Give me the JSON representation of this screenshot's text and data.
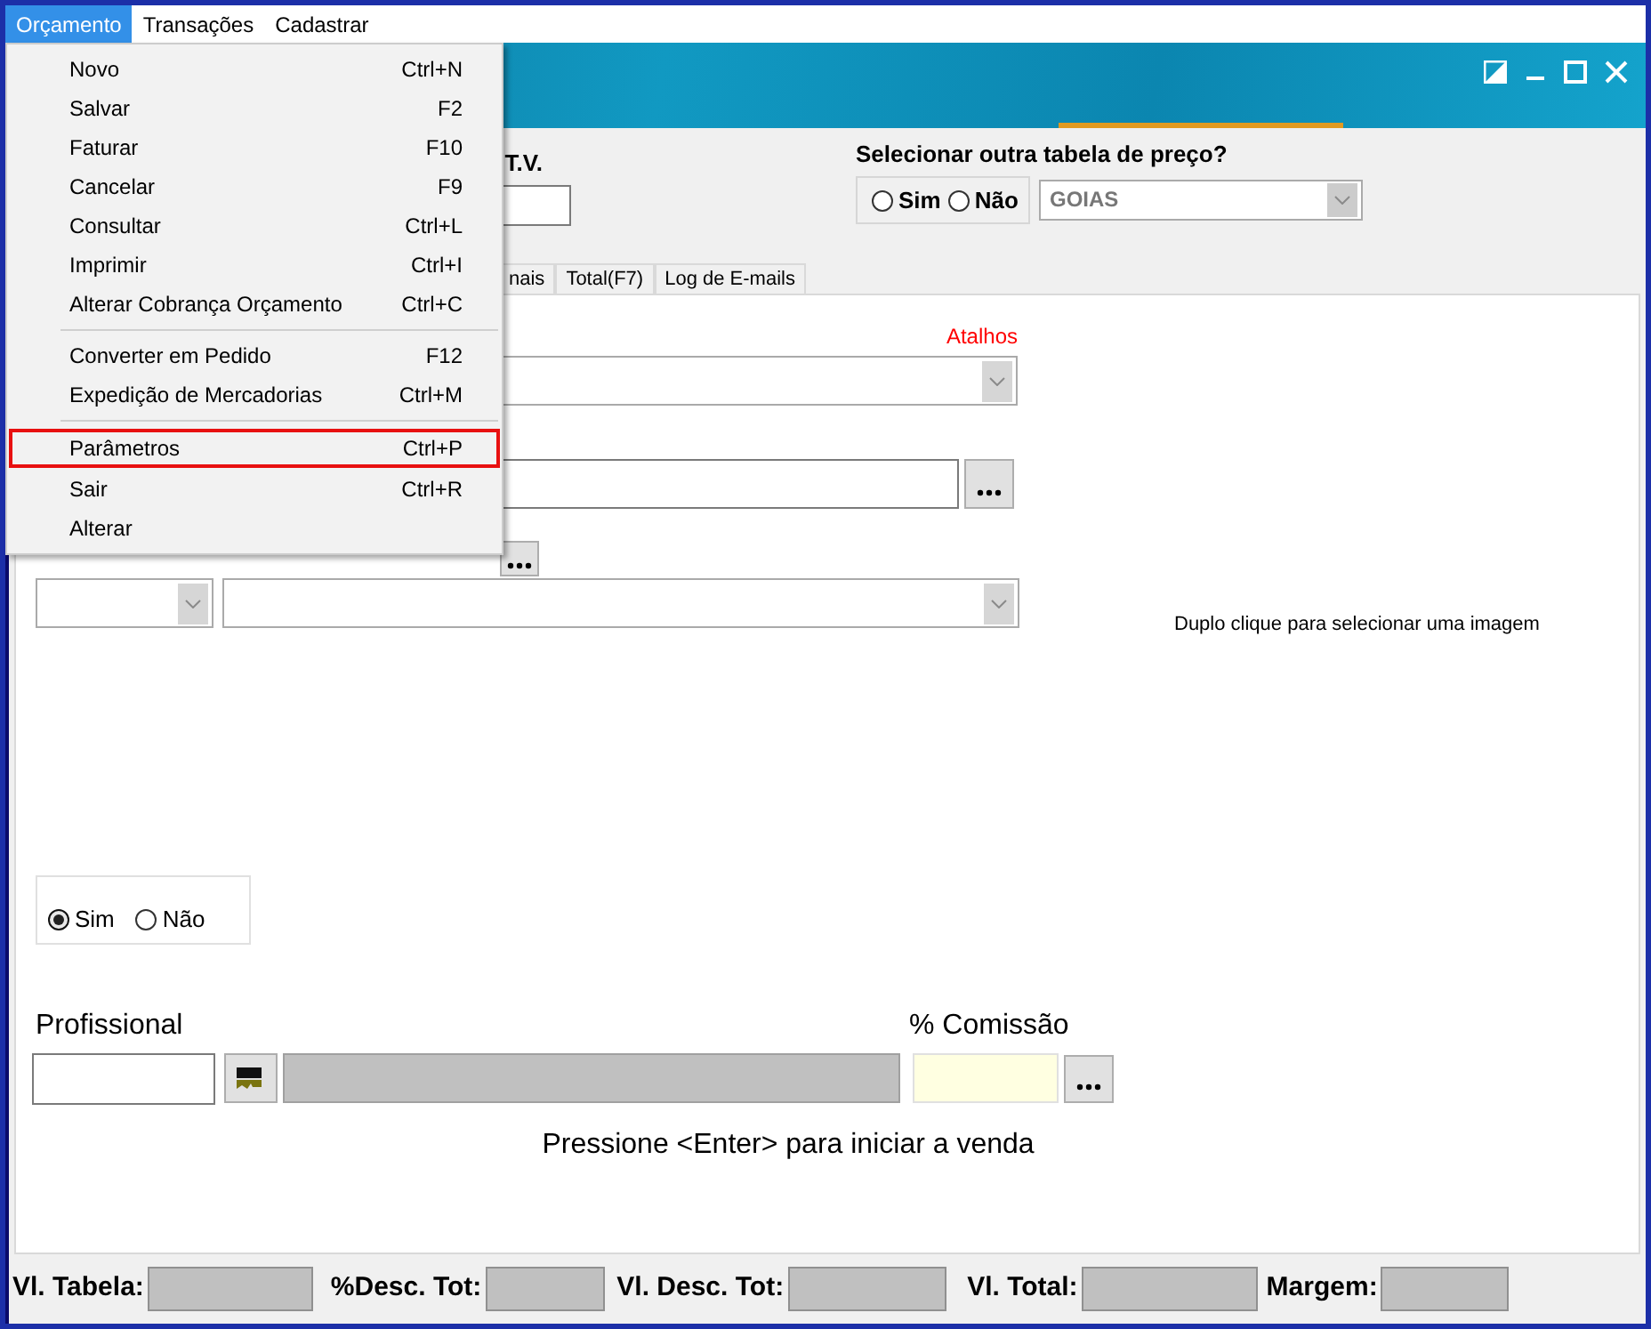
{
  "menu_bar": [
    {
      "label": "Orçamento",
      "selected": true
    },
    {
      "label": "Transações",
      "selected": false
    },
    {
      "label": "Cadastrar",
      "selected": false
    }
  ],
  "menu": {
    "items": [
      {
        "kind": "item",
        "label": "Novo",
        "shortcut": "Ctrl+N",
        "highlighted": false
      },
      {
        "kind": "item",
        "label": "Salvar",
        "shortcut": "F2",
        "highlighted": false
      },
      {
        "kind": "item",
        "label": "Faturar",
        "shortcut": "F10",
        "highlighted": false
      },
      {
        "kind": "item",
        "label": "Cancelar",
        "shortcut": "F9",
        "highlighted": false
      },
      {
        "kind": "item",
        "label": "Consultar",
        "shortcut": "Ctrl+L",
        "highlighted": false
      },
      {
        "kind": "item",
        "label": "Imprimir",
        "shortcut": "Ctrl+I",
        "highlighted": false
      },
      {
        "kind": "item",
        "label": "Alterar Cobrança Orçamento",
        "shortcut": "Ctrl+C",
        "highlighted": false
      },
      {
        "kind": "separator"
      },
      {
        "kind": "item",
        "label": "Converter em Pedido",
        "shortcut": "F12",
        "highlighted": false
      },
      {
        "kind": "item",
        "label": "Expedição de Mercadorias",
        "shortcut": "Ctrl+M",
        "highlighted": false
      },
      {
        "kind": "separator"
      },
      {
        "kind": "item",
        "label": "Parâmetros",
        "shortcut": "Ctrl+P",
        "highlighted": true
      },
      {
        "kind": "item",
        "label": "Sair",
        "shortcut": "Ctrl+R",
        "highlighted": false
      },
      {
        "kind": "item",
        "label": "Alterar",
        "highlighted": false
      }
    ]
  },
  "header": {
    "tv_label": "T.V.",
    "price_table": {
      "question": "Selecionar outra tabela de preço?",
      "options": [
        {
          "label": "Sim",
          "selected": false
        },
        {
          "label": "Não",
          "selected": false
        }
      ],
      "table": {
        "value": "GOIAS",
        "disabled": true
      }
    }
  },
  "tabs": [
    {
      "label": "nais",
      "selected": false
    },
    {
      "label": "Total(F7)",
      "selected": false
    },
    {
      "label": "Log de E-mails",
      "selected": false
    }
  ],
  "panel": {
    "shortcuts_link": "Atalhos",
    "image_hint": "Duplo clique para selecionar uma imagem",
    "options": [
      {
        "label": "Sim",
        "selected": true
      },
      {
        "label": "Não",
        "selected": false
      }
    ],
    "professional_label": "Profissional",
    "commission_label": "% Comissão",
    "enter_hint": "Pressione <Enter> para iniciar a venda"
  },
  "totals": [
    {
      "label": "Vl. Tabela:"
    },
    {
      "label": "%Desc. Tot:"
    },
    {
      "label": "Vl. Desc. Tot:"
    },
    {
      "label": "Vl. Total:"
    },
    {
      "label": "Margem:"
    }
  ]
}
